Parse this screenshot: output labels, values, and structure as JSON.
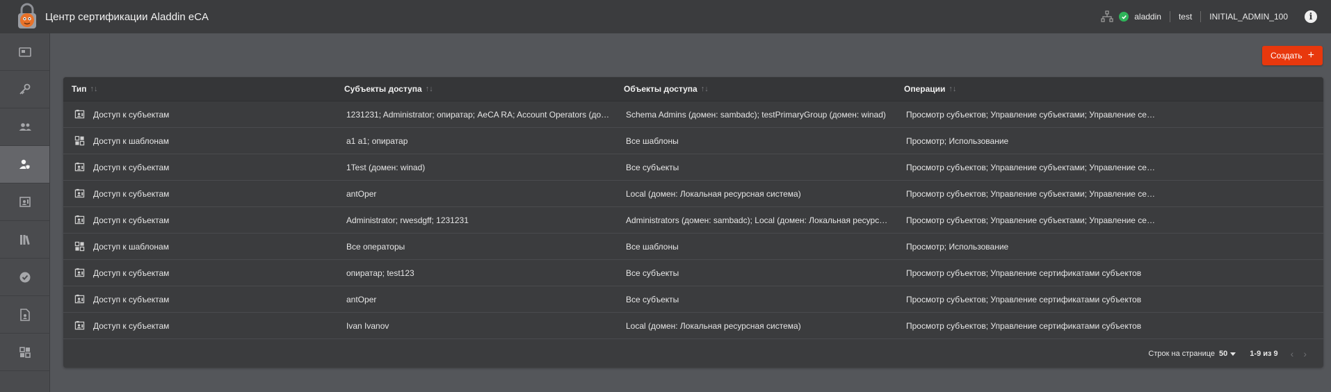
{
  "app": {
    "title": "Центр сертификации Aladdin eCA"
  },
  "header": {
    "user": "aladdin",
    "env": "test",
    "role": "INITIAL_ADMIN_100"
  },
  "sidebar": {
    "items": [
      {
        "name": "sidebar-item-dashboard",
        "icon": "card-icon"
      },
      {
        "name": "sidebar-item-keys",
        "icon": "key-icon"
      },
      {
        "name": "sidebar-item-users",
        "icon": "people-icon"
      },
      {
        "name": "sidebar-item-access",
        "icon": "user-shield-icon",
        "active": true
      },
      {
        "name": "sidebar-item-certificates",
        "icon": "certificate-icon"
      },
      {
        "name": "sidebar-item-library",
        "icon": "books-icon"
      },
      {
        "name": "sidebar-item-approved",
        "icon": "check-circle-icon"
      },
      {
        "name": "sidebar-item-documents",
        "icon": "document-icon"
      },
      {
        "name": "sidebar-item-templates",
        "icon": "grid-icon"
      }
    ]
  },
  "toolbar": {
    "create_label": "Создать",
    "create_icon": "+"
  },
  "table": {
    "columns": [
      "Тип",
      "Субъекты доступа",
      "Объекты доступа",
      "Операции"
    ],
    "sort_glyph": "↑↓",
    "rows": [
      {
        "type": "Доступ к субъектам",
        "subjects": "1231231; Administrator; опиратар; AeCA RA; Account Operators (домен: sambadc)",
        "objects": "Schema Admins (домен: sambadc); testPrimaryGroup (домен: winad)",
        "ops": "Просмотр субъектов; Управление субъектами; Управление сертификатами субъектов"
      },
      {
        "type": "Доступ к шаблонам",
        "subjects": "a1 a1; опиратар",
        "objects": "Все шаблоны",
        "ops": "Просмотр; Использование"
      },
      {
        "type": "Доступ к субъектам",
        "subjects": "1Test (домен: winad)",
        "objects": "Все субъекты",
        "ops": "Просмотр субъектов; Управление субъектами; Управление сертификатами субъектов"
      },
      {
        "type": "Доступ к субъектам",
        "subjects": "antOper",
        "objects": "Local (домен: Локальная ресурсная система)",
        "ops": "Просмотр субъектов; Управление субъектами; Управление сертификатами субъектов"
      },
      {
        "type": "Доступ к субъектам",
        "subjects": "Administrator; rwesdgff; 1231231",
        "objects": "Administrators (домен: sambadc); Local (домен: Локальная ресурсная система)",
        "ops": "Просмотр субъектов; Управление субъектами; Управление сертификатами субъектов"
      },
      {
        "type": "Доступ к шаблонам",
        "subjects": "Все операторы",
        "objects": "Все шаблоны",
        "ops": "Просмотр; Использование"
      },
      {
        "type": "Доступ к субъектам",
        "subjects": "опиратар; test123",
        "objects": "Все субъекты",
        "ops": "Просмотр субъектов; Управление сертификатами субъектов"
      },
      {
        "type": "Доступ к субъектам",
        "subjects": "antOper",
        "objects": "Все субъекты",
        "ops": "Просмотр субъектов; Управление сертификатами субъектов"
      },
      {
        "type": "Доступ к субъектам",
        "subjects": "Ivan Ivanov",
        "objects": "Local (домен: Локальная ресурсная система)",
        "ops": "Просмотр субъектов; Управление сертификатами субъектов"
      }
    ]
  },
  "pagination": {
    "rows_per_page_label": "Строк на странице",
    "rows_per_page": "50",
    "range": "1-9 из 9"
  },
  "colors": {
    "accent": "#e8380d",
    "header_bg": "#3b3c3e",
    "page_bg": "#54565a",
    "status_ok": "#2fb45a"
  }
}
